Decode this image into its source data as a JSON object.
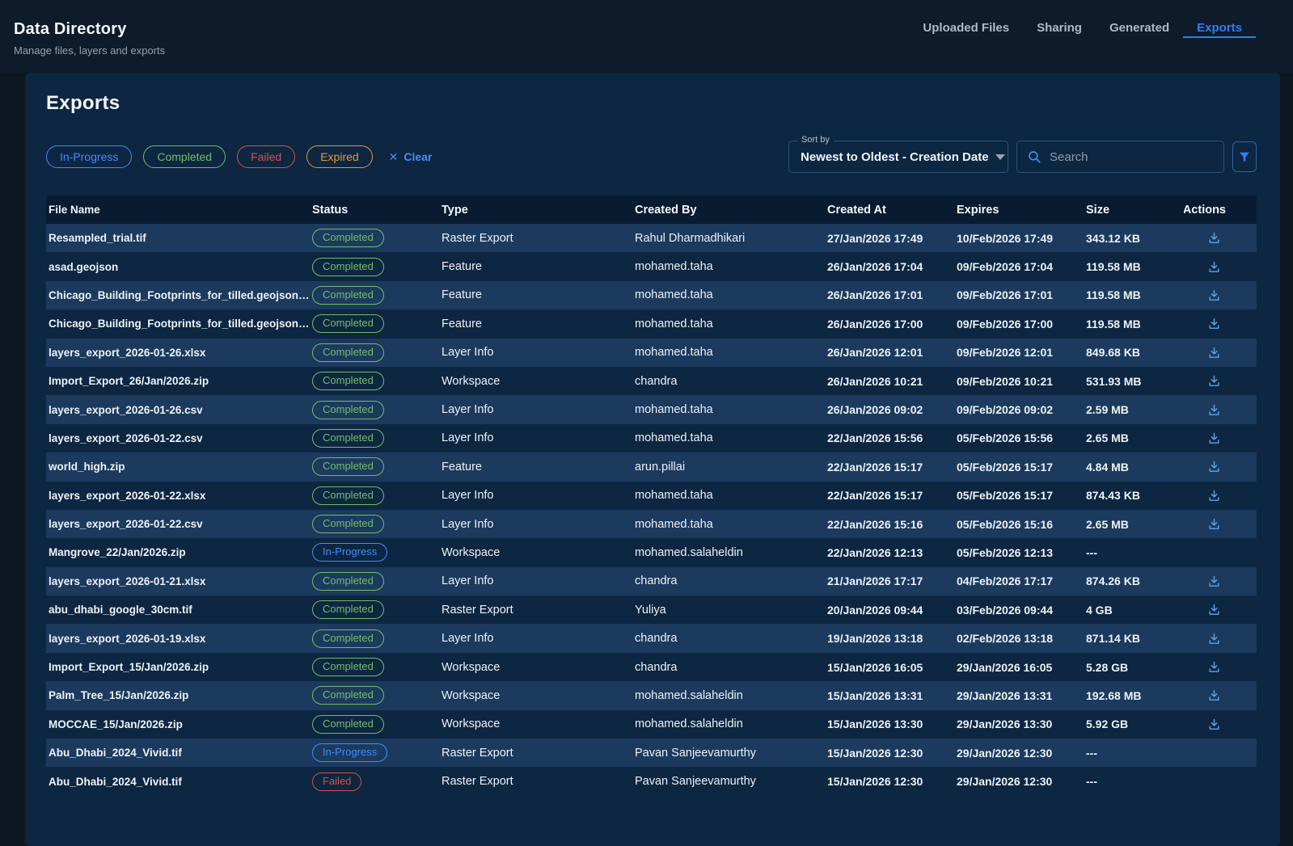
{
  "header": {
    "title": "Data Directory",
    "subtitle": "Manage files, layers and exports",
    "tabs": [
      {
        "label": "Uploaded Files",
        "active": false
      },
      {
        "label": "Sharing",
        "active": false
      },
      {
        "label": "Generated",
        "active": false
      },
      {
        "label": "Exports",
        "active": true
      }
    ]
  },
  "panel": {
    "title": "Exports"
  },
  "filters": {
    "chips": [
      {
        "label": "In-Progress",
        "variant": "in-progress"
      },
      {
        "label": "Completed",
        "variant": "completed"
      },
      {
        "label": "Failed",
        "variant": "failed"
      },
      {
        "label": "Expired",
        "variant": "expired"
      }
    ],
    "clear_label": "Clear"
  },
  "sort": {
    "label": "Sort by",
    "value": "Newest to Oldest - Creation Date"
  },
  "search": {
    "placeholder": "Search"
  },
  "colors": {
    "accent_blue": "#3f8cff",
    "status_completed": "#72bd67",
    "status_in_progress": "#3f8cff",
    "status_failed": "#d4524e",
    "status_expired": "#e09a3b",
    "download_icon": "#5ea4e8"
  },
  "table": {
    "columns": [
      "File Name",
      "Status",
      "Type",
      "Created By",
      "Created At",
      "Expires",
      "Size",
      "Actions"
    ],
    "rows": [
      {
        "file": "Resampled_trial.tif",
        "status": "Completed",
        "variant": "completed",
        "type": "Raster Export",
        "by": "Rahul Dharmadhikari",
        "created": "27/Jan/2026 17:49",
        "expires": "10/Feb/2026 17:49",
        "size": "343.12 KB",
        "download": true
      },
      {
        "file": "asad.geojson",
        "status": "Completed",
        "variant": "completed",
        "type": "Feature",
        "by": "mohamed.taha",
        "created": "26/Jan/2026 17:04",
        "expires": "09/Feb/2026 17:04",
        "size": "119.58 MB",
        "download": true
      },
      {
        "file": "Chicago_Building_Footprints_for_tilled.geojson.g...",
        "status": "Completed",
        "variant": "completed",
        "type": "Feature",
        "by": "mohamed.taha",
        "created": "26/Jan/2026 17:01",
        "expires": "09/Feb/2026 17:01",
        "size": "119.58 MB",
        "download": true
      },
      {
        "file": "Chicago_Building_Footprints_for_tilled.geojson.g...",
        "status": "Completed",
        "variant": "completed",
        "type": "Feature",
        "by": "mohamed.taha",
        "created": "26/Jan/2026 17:00",
        "expires": "09/Feb/2026 17:00",
        "size": "119.58 MB",
        "download": true
      },
      {
        "file": "layers_export_2026-01-26.xlsx",
        "status": "Completed",
        "variant": "completed",
        "type": "Layer Info",
        "by": "mohamed.taha",
        "created": "26/Jan/2026 12:01",
        "expires": "09/Feb/2026 12:01",
        "size": "849.68 KB",
        "download": true
      },
      {
        "file": "Import_Export_26/Jan/2026.zip",
        "status": "Completed",
        "variant": "completed",
        "type": "Workspace",
        "by": "chandra",
        "created": "26/Jan/2026 10:21",
        "expires": "09/Feb/2026 10:21",
        "size": "531.93 MB",
        "download": true
      },
      {
        "file": "layers_export_2026-01-26.csv",
        "status": "Completed",
        "variant": "completed",
        "type": "Layer Info",
        "by": "mohamed.taha",
        "created": "26/Jan/2026 09:02",
        "expires": "09/Feb/2026 09:02",
        "size": "2.59 MB",
        "download": true
      },
      {
        "file": "layers_export_2026-01-22.csv",
        "status": "Completed",
        "variant": "completed",
        "type": "Layer Info",
        "by": "mohamed.taha",
        "created": "22/Jan/2026 15:56",
        "expires": "05/Feb/2026 15:56",
        "size": "2.65 MB",
        "download": true
      },
      {
        "file": "world_high.zip",
        "status": "Completed",
        "variant": "completed",
        "type": "Feature",
        "by": "arun.pillai",
        "created": "22/Jan/2026 15:17",
        "expires": "05/Feb/2026 15:17",
        "size": "4.84 MB",
        "download": true
      },
      {
        "file": "layers_export_2026-01-22.xlsx",
        "status": "Completed",
        "variant": "completed",
        "type": "Layer Info",
        "by": "mohamed.taha",
        "created": "22/Jan/2026 15:17",
        "expires": "05/Feb/2026 15:17",
        "size": "874.43 KB",
        "download": true
      },
      {
        "file": "layers_export_2026-01-22.csv",
        "status": "Completed",
        "variant": "completed",
        "type": "Layer Info",
        "by": "mohamed.taha",
        "created": "22/Jan/2026 15:16",
        "expires": "05/Feb/2026 15:16",
        "size": "2.65 MB",
        "download": true
      },
      {
        "file": "Mangrove_22/Jan/2026.zip",
        "status": "In-Progress",
        "variant": "in-progress",
        "type": "Workspace",
        "by": "mohamed.salaheldin",
        "created": "22/Jan/2026 12:13",
        "expires": "05/Feb/2026 12:13",
        "size": "---",
        "download": false
      },
      {
        "file": "layers_export_2026-01-21.xlsx",
        "status": "Completed",
        "variant": "completed",
        "type": "Layer Info",
        "by": "chandra",
        "created": "21/Jan/2026 17:17",
        "expires": "04/Feb/2026 17:17",
        "size": "874.26 KB",
        "download": true
      },
      {
        "file": "abu_dhabi_google_30cm.tif",
        "status": "Completed",
        "variant": "completed",
        "type": "Raster Export",
        "by": "Yuliya",
        "created": "20/Jan/2026 09:44",
        "expires": "03/Feb/2026 09:44",
        "size": "4 GB",
        "download": true
      },
      {
        "file": "layers_export_2026-01-19.xlsx",
        "status": "Completed",
        "variant": "completed",
        "type": "Layer Info",
        "by": "chandra",
        "created": "19/Jan/2026 13:18",
        "expires": "02/Feb/2026 13:18",
        "size": "871.14 KB",
        "download": true
      },
      {
        "file": "Import_Export_15/Jan/2026.zip",
        "status": "Completed",
        "variant": "completed",
        "type": "Workspace",
        "by": "chandra",
        "created": "15/Jan/2026 16:05",
        "expires": "29/Jan/2026 16:05",
        "size": "5.28 GB",
        "download": true
      },
      {
        "file": "Palm_Tree_15/Jan/2026.zip",
        "status": "Completed",
        "variant": "completed",
        "type": "Workspace",
        "by": "mohamed.salaheldin",
        "created": "15/Jan/2026 13:31",
        "expires": "29/Jan/2026 13:31",
        "size": "192.68 MB",
        "download": true
      },
      {
        "file": "MOCCAE_15/Jan/2026.zip",
        "status": "Completed",
        "variant": "completed",
        "type": "Workspace",
        "by": "mohamed.salaheldin",
        "created": "15/Jan/2026 13:30",
        "expires": "29/Jan/2026 13:30",
        "size": "5.92 GB",
        "download": true
      },
      {
        "file": "Abu_Dhabi_2024_Vivid.tif",
        "status": "In-Progress",
        "variant": "in-progress",
        "type": "Raster Export",
        "by": "Pavan Sanjeevamurthy",
        "created": "15/Jan/2026 12:30",
        "expires": "29/Jan/2026 12:30",
        "size": "---",
        "download": false
      },
      {
        "file": "Abu_Dhabi_2024_Vivid.tif",
        "status": "Failed",
        "variant": "failed",
        "type": "Raster Export",
        "by": "Pavan Sanjeevamurthy",
        "created": "15/Jan/2026 12:30",
        "expires": "29/Jan/2026 12:30",
        "size": "---",
        "download": false
      }
    ]
  }
}
